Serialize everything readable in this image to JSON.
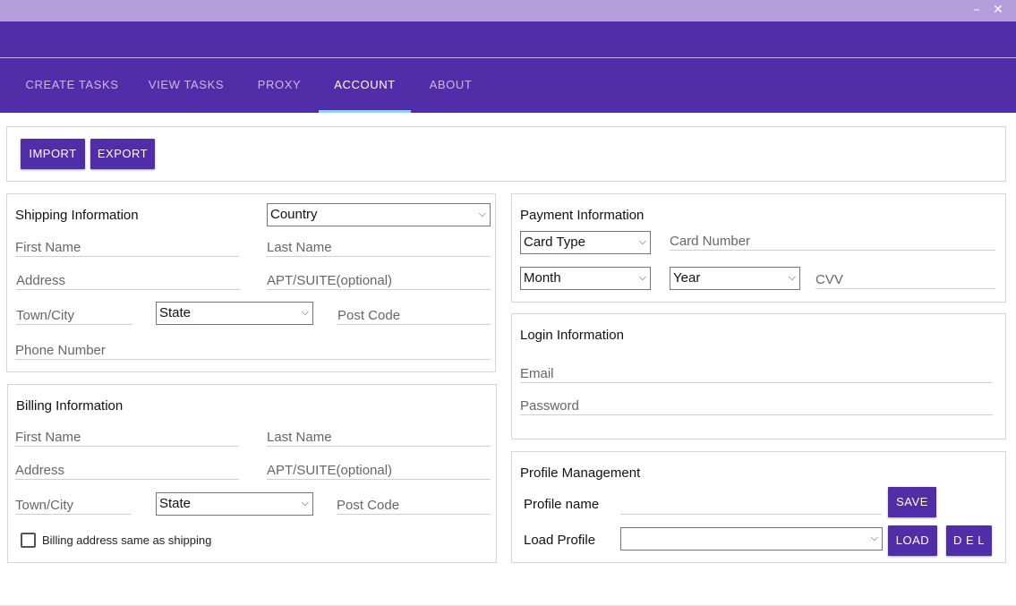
{
  "window": {
    "minimize_glyph": "–",
    "close_glyph": "✕"
  },
  "tabs": [
    {
      "label": "CREATE TASKS",
      "active": false
    },
    {
      "label": "VIEW TASKS",
      "active": false
    },
    {
      "label": "PROXY",
      "active": false
    },
    {
      "label": "ACCOUNT",
      "active": true
    },
    {
      "label": "ABOUT",
      "active": false
    }
  ],
  "toolbar": {
    "import_label": "IMPORT",
    "export_label": "EXPORT"
  },
  "shipping": {
    "title": "Shipping Information",
    "country": "Country",
    "first_name": "First Name",
    "last_name": "Last Name",
    "address": "Address",
    "apt": "APT/SUITE(optional)",
    "town": "Town/City",
    "state": "State",
    "post_code": "Post Code",
    "phone": "Phone Number"
  },
  "billing": {
    "title": "Billing Information",
    "first_name": "First Name",
    "last_name": "Last Name",
    "address": "Address",
    "apt": "APT/SUITE(optional)",
    "town": "Town/City",
    "state": "State",
    "post_code": "Post Code",
    "same_as_shipping": "Billing address same as shipping",
    "same_as_shipping_checked": false
  },
  "payment": {
    "title": "Payment Information",
    "card_type": "Card Type",
    "card_number": "Card Number",
    "month": "Month",
    "year": "Year",
    "cvv": "CVV"
  },
  "login": {
    "title": "Login Information",
    "email": "Email",
    "password": "Password"
  },
  "profile": {
    "title": "Profile Management",
    "profile_name_label": "Profile name",
    "load_profile_label": "Load Profile",
    "load_profile_value": "",
    "save_label": "SAVE",
    "load_label": "LOAD",
    "del_label": "D E L"
  },
  "colors": {
    "titlebar": "#b39ddb",
    "primary": "#512da8",
    "tab_indicator": "#80d8ff",
    "tab_inactive_text": "#c7bbe8",
    "tab_active_text": "#ffffff"
  },
  "icons": {
    "minimize": "minimize-icon",
    "close": "close-icon",
    "dropdown": "chevron-down-icon"
  }
}
